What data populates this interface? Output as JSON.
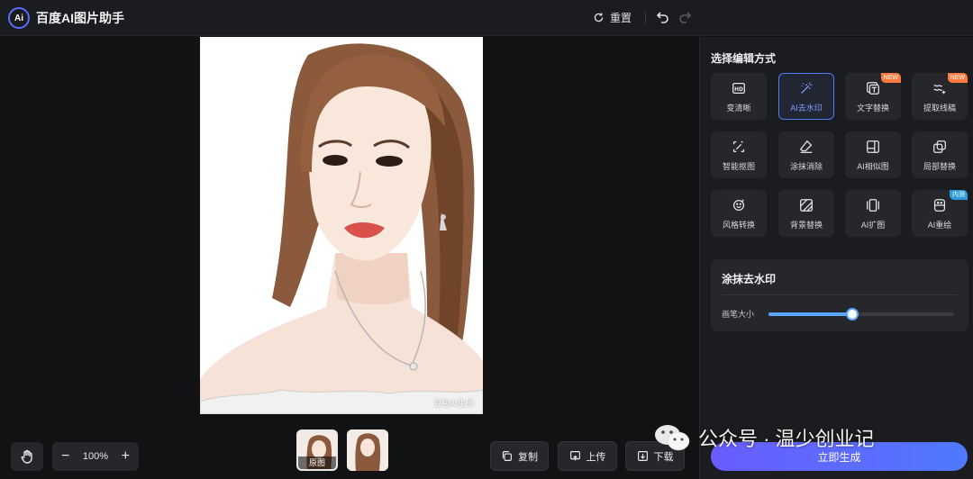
{
  "header": {
    "logo_text": "Ai",
    "app_title": "百度AI图片助手",
    "reset_label": "重置"
  },
  "panel": {
    "title": "选择编辑方式",
    "tools": [
      {
        "label": "变清晰",
        "icon": "hd-icon",
        "badge": ""
      },
      {
        "label": "AI去水印",
        "icon": "magic-wand-icon",
        "badge": ""
      },
      {
        "label": "文字替换",
        "icon": "text-replace-icon",
        "badge": "NEW"
      },
      {
        "label": "提取线稿",
        "icon": "line-art-icon",
        "badge": "NEW"
      },
      {
        "label": "智能抠图",
        "icon": "smart-cutout-icon",
        "badge": ""
      },
      {
        "label": "涂抹消除",
        "icon": "eraser-icon",
        "badge": ""
      },
      {
        "label": "AI相似图",
        "icon": "similar-image-icon",
        "badge": ""
      },
      {
        "label": "局部替换",
        "icon": "partial-replace-icon",
        "badge": ""
      },
      {
        "label": "风格转换",
        "icon": "style-transfer-icon",
        "badge": ""
      },
      {
        "label": "背景替换",
        "icon": "background-replace-icon",
        "badge": ""
      },
      {
        "label": "AI扩图",
        "icon": "expand-image-icon",
        "badge": ""
      },
      {
        "label": "AI重绘",
        "icon": "redraw-icon",
        "badge": "内测"
      }
    ],
    "selected_tool": "AI去水印",
    "sub": {
      "title": "涂抹去水印",
      "brush_label": "画笔大小",
      "brush_size_fraction": 0.45
    },
    "generate_label": "立即生成"
  },
  "image": {
    "watermark": "豆包AI生成"
  },
  "bottom": {
    "zoom_level": "100%",
    "zoom_out": "−",
    "zoom_in": "+",
    "thumb_original_label": "原图",
    "copy_label": "复制",
    "upload_label": "上传",
    "download_label": "下载"
  },
  "overlay": {
    "wechat_text": "公众号 · 温少创业记"
  },
  "colors": {
    "accent": "#4e7cff",
    "badge_new": "#ff7a3c",
    "badge_test": "#2c9dd8",
    "slider": "#5aa6ff"
  }
}
